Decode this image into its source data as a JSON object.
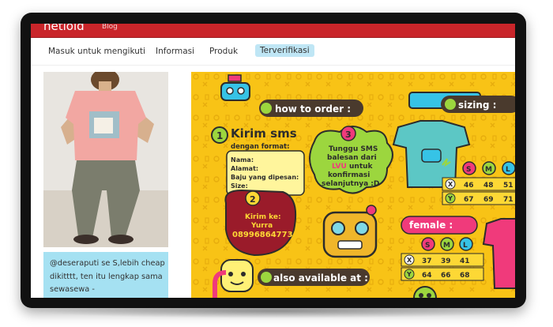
{
  "topbar": {
    "brand": "netlold",
    "brand_sub": "Blog"
  },
  "nav": {
    "items": [
      {
        "label": "Masuk untuk mengikuti"
      },
      {
        "label": "Informasi"
      },
      {
        "label": "Produk"
      },
      {
        "label": "Terverifikasi"
      }
    ],
    "active_index": 3
  },
  "caption": {
    "text": "@deseraputi se S,lebih cheap dikitttt, ten itu lengkap sama sewasewa -"
  },
  "poster": {
    "how_to_order": "how to order :",
    "sizing": "sizing :",
    "step1_title": "Kirim sms",
    "step1_sub": "dengan format:",
    "form_fields": [
      "Nama:",
      "Alamat:",
      "Baju yang dipesan:",
      "Size:"
    ],
    "step2_label": "Kirim ke:",
    "step2_name": "Yurra",
    "step2_phone": "08996864773",
    "step3_line1": "Tunggu SMS",
    "step3_line2": "balesan dari",
    "step3_brand": "LVU",
    "step3_line3": "untuk",
    "step3_line4": "konfirmasi",
    "step3_line5": "selanjutnya :D",
    "female": "female :",
    "also_available": "also available at :",
    "size_headers": [
      "S",
      "M",
      "L"
    ],
    "male_rows": [
      {
        "label": "X",
        "values": [
          "46",
          "48",
          "51"
        ]
      },
      {
        "label": "Y",
        "values": [
          "67",
          "69",
          "71"
        ]
      }
    ],
    "female_rows": [
      {
        "label": "X",
        "values": [
          "37",
          "39",
          "41"
        ]
      },
      {
        "label": "Y",
        "values": [
          "64",
          "66",
          "68"
        ]
      }
    ],
    "step_numbers": [
      "1",
      "2",
      "3"
    ]
  },
  "colors": {
    "topbar": "#c9252a",
    "poster_bg": "#f8c316",
    "caption_bg": "#a5e1f2",
    "nav_active": "#bfe6f5"
  }
}
